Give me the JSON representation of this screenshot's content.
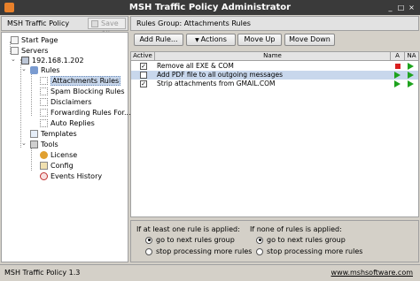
{
  "window": {
    "title": "MSH Traffic Policy Administrator"
  },
  "left_panel": {
    "title": "MSH Traffic Policy",
    "save_all_label": "Save All"
  },
  "tree": {
    "start_page": "Start Page",
    "servers": "Servers",
    "server_ip": "192.168.1.202",
    "rules": "Rules",
    "attachments_rules": "Attachments Rules",
    "spam_blocking_rules": "Spam Blocking Rules",
    "disclaimers": "Disclaimers",
    "forwarding_rules": "Forwarding Rules For...",
    "auto_replies": "Auto Replies",
    "templates": "Templates",
    "tools": "Tools",
    "license": "License",
    "config": "Config",
    "events_history": "Events History"
  },
  "right_panel": {
    "title": "Rules Group: Attachments Rules"
  },
  "toolbar": {
    "add_rule": "Add Rule...",
    "actions": "Actions",
    "move_up": "Move Up",
    "move_down": "Move Down"
  },
  "table": {
    "columns": {
      "active": "Active",
      "name": "Name",
      "a": "A",
      "na": "NA"
    },
    "rows": [
      {
        "active": true,
        "name": "Remove all EXE & COM"
      },
      {
        "active": false,
        "name": "Add PDF file to all outgoing messages"
      },
      {
        "active": true,
        "name": "Strip attachments from GMAIL.COM"
      }
    ]
  },
  "bottom": {
    "applied_title": "If at least one rule is applied:",
    "applied_next": "go to next rules group",
    "applied_stop": "stop processing more rules",
    "none_title": "If none of rules is applied:",
    "none_next": "go to next rules group",
    "none_stop": "stop processing more rules"
  },
  "status": {
    "version": "MSH Traffic Policy 1.3",
    "link": "www.mshsoftware.com"
  },
  "colors": {
    "selection": "#c8d7ec",
    "play": "#1ea31e",
    "stop": "#d92020",
    "titlebar": "#3a3a3a"
  }
}
